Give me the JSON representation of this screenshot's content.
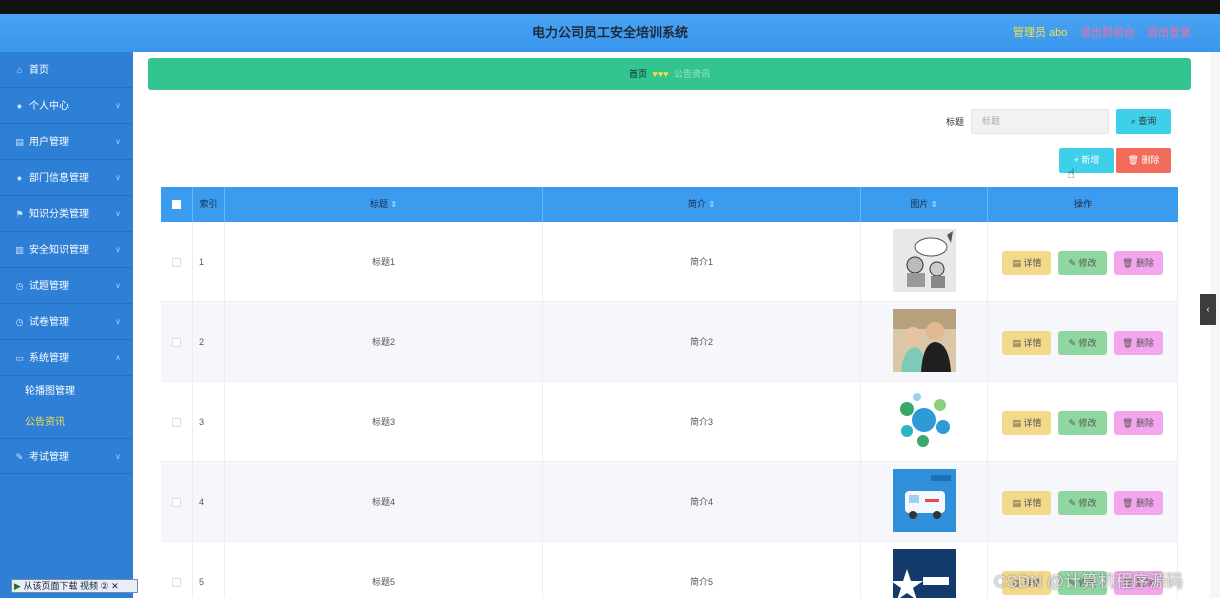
{
  "header": {
    "title": "电力公司员工安全培训系统",
    "admin_label": "管理员 abo",
    "back_label": "退出到前台",
    "logout_label": "退出登录"
  },
  "sidebar": {
    "items": [
      {
        "label": "首页",
        "icon": "home-icon",
        "has_arrow": false
      },
      {
        "label": "个人中心",
        "icon": "user-icon",
        "has_arrow": true
      },
      {
        "label": "用户管理",
        "icon": "document-icon",
        "has_arrow": true
      },
      {
        "label": "部门信息管理",
        "icon": "user-icon",
        "has_arrow": true
      },
      {
        "label": "知识分类管理",
        "icon": "flag-icon",
        "has_arrow": true
      },
      {
        "label": "安全知识管理",
        "icon": "bank-icon",
        "has_arrow": true
      },
      {
        "label": "试题管理",
        "icon": "clock-icon",
        "has_arrow": true
      },
      {
        "label": "试卷管理",
        "icon": "clock-icon",
        "has_arrow": true
      },
      {
        "label": "系统管理",
        "icon": "chat-icon",
        "has_arrow": true
      }
    ],
    "sub_items": [
      {
        "label": "轮播图管理"
      },
      {
        "label": "公告资讯"
      }
    ],
    "last_item": {
      "label": "考试管理",
      "icon": "edit-icon"
    }
  },
  "breadcrumb": {
    "home": "首页",
    "hearts": "♥♥♥",
    "current": "公告资讯"
  },
  "search": {
    "label": "标题",
    "placeholder": "标题",
    "query_button": "查询"
  },
  "toolbar": {
    "add_label": "新增",
    "delete_label": "删除"
  },
  "table": {
    "headers": {
      "index": "索引",
      "title": "标题",
      "intro": "简介",
      "image": "图片",
      "actions": "操作"
    },
    "rows": [
      {
        "index": "1",
        "title": "标题1",
        "intro": "简介1"
      },
      {
        "index": "2",
        "title": "标题2",
        "intro": "简介2"
      },
      {
        "index": "3",
        "title": "标题3",
        "intro": "简介3"
      },
      {
        "index": "4",
        "title": "标题4",
        "intro": "简介4"
      },
      {
        "index": "5",
        "title": "标题5",
        "intro": "简介5"
      }
    ],
    "action_labels": {
      "detail": "详情",
      "edit": "修改",
      "delete": "删除"
    }
  },
  "bottom_tool": {
    "label": "从该页面下载 视频"
  },
  "watermark": "CSDN @计算机程序源码",
  "colors": {
    "header_bg": "#3a96ee",
    "sidebar_bg": "#2e7fd6",
    "breadcrumb_bg": "#33c48f",
    "table_head_bg": "#3a9bef",
    "query_button": "#3ed0e8",
    "delete_button": "#f26b5b"
  }
}
